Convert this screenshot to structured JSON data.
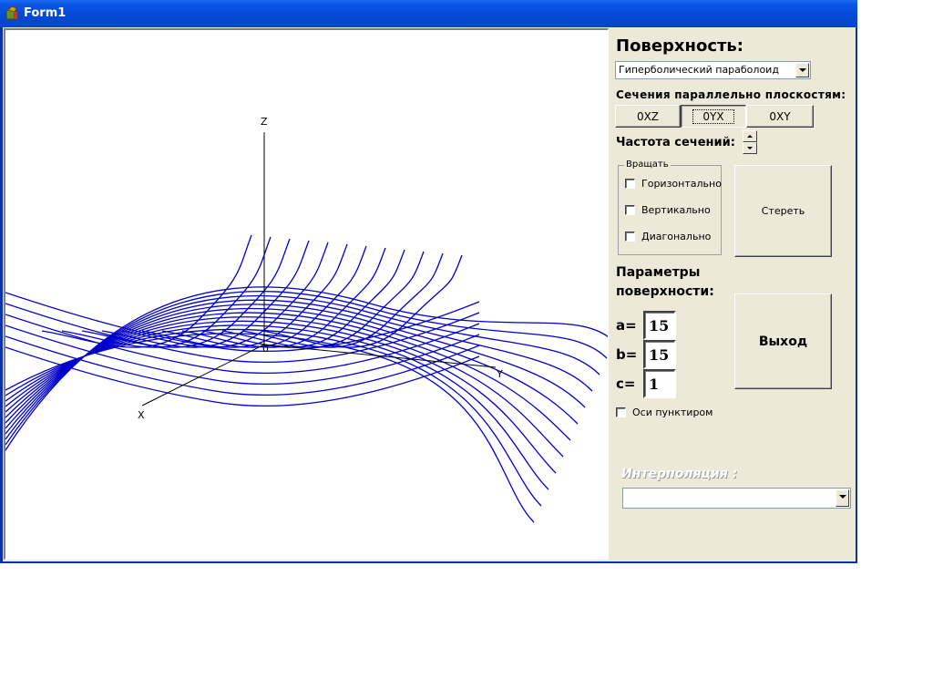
{
  "window": {
    "title": "Form1"
  },
  "canvas": {
    "axes": {
      "z": "Z",
      "y": "Y",
      "x": "X",
      "origin": "0"
    },
    "curve_color": "#0000cc"
  },
  "panel": {
    "surface_title": "Поверхность:",
    "surface_select": {
      "value": "Гиперболический параболоид"
    },
    "sections_title": "Сечения параллельно плоскостям:",
    "plane_buttons": [
      {
        "label": "0XZ",
        "pressed": false
      },
      {
        "label": "0YX",
        "pressed": true
      },
      {
        "label": "0XY",
        "pressed": false
      }
    ],
    "frequency_label": "Частота сечений:",
    "rotate_group": {
      "legend": "Вращать",
      "options": [
        "Горизонтально",
        "Вертикально",
        "Диагонально"
      ]
    },
    "erase_button": "Стереть",
    "params_title_line1": "Параметры",
    "params_title_line2": "поверхности:",
    "params": [
      {
        "label": "a=",
        "value": "15"
      },
      {
        "label": "b=",
        "value": "15"
      },
      {
        "label": "c=",
        "value": "1"
      }
    ],
    "exit_button": "Выход",
    "dotted_axes_label": "Оси пунктиром",
    "disabled_label": "Интерполяция :",
    "bottom_select": {
      "value": ""
    }
  }
}
